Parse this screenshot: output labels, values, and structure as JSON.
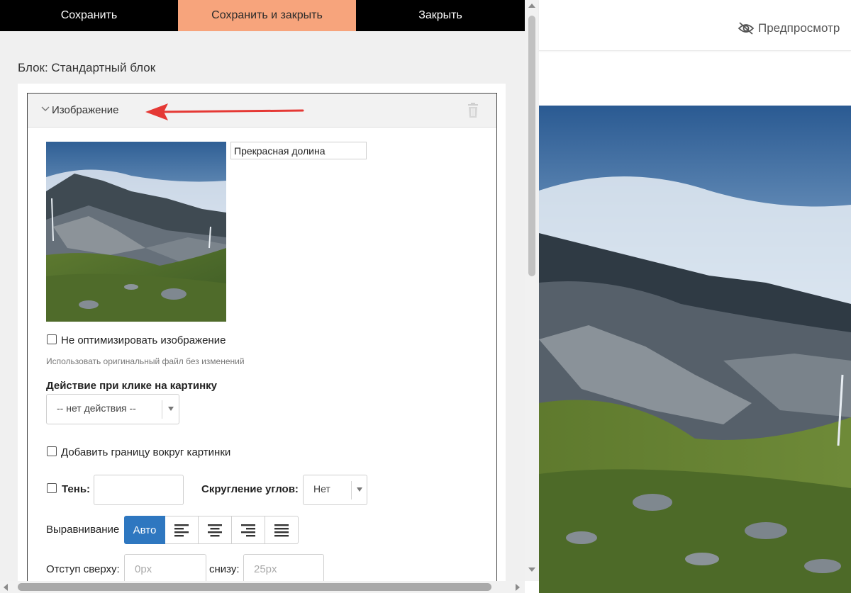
{
  "toolbar": {
    "save_label": "Сохранить",
    "save_close_label": "Сохранить и закрыть",
    "close_label": "Закрыть"
  },
  "editor": {
    "block_title": "Блок: Стандартный блок",
    "section_title": "Изображение",
    "caption_value": "Прекрасная долина",
    "no_optimize_label": "Не оптимизировать изображение",
    "no_optimize_hint": "Использовать оригинальный файл без изменений",
    "click_action_label": "Действие при клике на картинку",
    "click_action_value": "-- нет действия --",
    "add_border_label": "Добавить границу вокруг картинки",
    "shadow_label": "Тень:",
    "radius_label": "Скругление углов:",
    "radius_value": "Нет",
    "align_label": "Выравнивание",
    "align_auto_label": "Авто",
    "margin_top_label": "Отступ сверху:",
    "margin_top_placeholder": "0px",
    "margin_bottom_label": "снизу:",
    "margin_bottom_placeholder": "25px"
  },
  "preview": {
    "button_label": "Предпросмотр"
  },
  "colors": {
    "save_close_bg": "#f7a47c",
    "toolbar_bg": "#000000",
    "align_active_bg": "#2e77c0",
    "annotation_arrow": "#e53935"
  },
  "icons": [
    "chevron-down-icon",
    "trash-icon",
    "eye-off-icon",
    "align-left-icon",
    "align-center-icon",
    "align-right-icon",
    "align-justify-icon"
  ]
}
